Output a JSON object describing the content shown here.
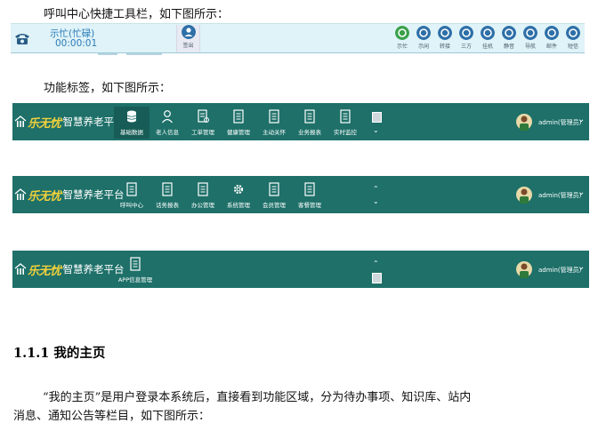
{
  "doc": {
    "p1": "呼叫中心快捷工具栏，如下图所示：",
    "p2": "功能标签，如下图所示：",
    "heading": "1.1.1 我的主页",
    "p3_line1": "“我的主页”是用户登录本系统后，直接看到功能区域，分为待办事项、知识库、站内",
    "p3_line2": "消息、通知公告等栏目，如下图所示："
  },
  "callbar": {
    "status_line1": "示忙(忙碌)",
    "status_line2": "00:00:01",
    "signout_label": "签出",
    "buttons": [
      {
        "label": "示忙",
        "icon": "phone-answer-icon",
        "color": "#3aa04a"
      },
      {
        "label": "示闲",
        "icon": "idle-icon",
        "color": "#2e6fa8"
      },
      {
        "label": "转接",
        "icon": "transfer-icon",
        "color": "#2e6fa8"
      },
      {
        "label": "三方",
        "icon": "three-way-icon",
        "color": "#2e6fa8"
      },
      {
        "label": "挂机",
        "icon": "hangup-icon",
        "color": "#2e6fa8"
      },
      {
        "label": "静音",
        "icon": "mute-icon",
        "color": "#2e6fa8"
      },
      {
        "label": "导航",
        "icon": "navigate-icon",
        "color": "#2e6fa8"
      },
      {
        "label": "邮件",
        "icon": "mail-icon",
        "color": "#2e6fa8"
      },
      {
        "label": "短信",
        "icon": "sms-icon",
        "color": "#2e6fa8"
      }
    ]
  },
  "brand": {
    "name_part1": "乐无忧",
    "name_part2": "智慧养老平台"
  },
  "user": {
    "label": "admin(管理员)"
  },
  "navbar1": {
    "items": [
      {
        "label": "基础数据",
        "icon": "database-icon",
        "selected": true
      },
      {
        "label": "老人信息",
        "icon": "person-icon",
        "selected": false
      },
      {
        "label": "工单管理",
        "icon": "work-order-icon",
        "selected": false
      },
      {
        "label": "健康管理",
        "icon": "document-icon",
        "selected": false
      },
      {
        "label": "主动关怀",
        "icon": "document-icon",
        "selected": false
      },
      {
        "label": "业务报表",
        "icon": "document-icon",
        "selected": false
      },
      {
        "label": "实时监控",
        "icon": "document-icon",
        "selected": false
      }
    ]
  },
  "navbar2": {
    "items": [
      {
        "label": "呼叫中心",
        "icon": "document-icon"
      },
      {
        "label": "话务报表",
        "icon": "document-icon"
      },
      {
        "label": "办公管理",
        "icon": "document-icon"
      },
      {
        "label": "系统管理",
        "icon": "gear-icon"
      },
      {
        "label": "会员管理",
        "icon": "document-icon"
      },
      {
        "label": "客餐管理",
        "icon": "document-icon"
      }
    ]
  },
  "navbar3": {
    "items": [
      {
        "label": "APP信息管理",
        "icon": "document-icon"
      }
    ]
  },
  "colors": {
    "nav_bg": "#1e7069",
    "nav_selected": "#175c56",
    "toolbar_bg": "#dff3f8",
    "brand_yellow": "#f2d23b",
    "status_blue": "#2a7ab8"
  }
}
